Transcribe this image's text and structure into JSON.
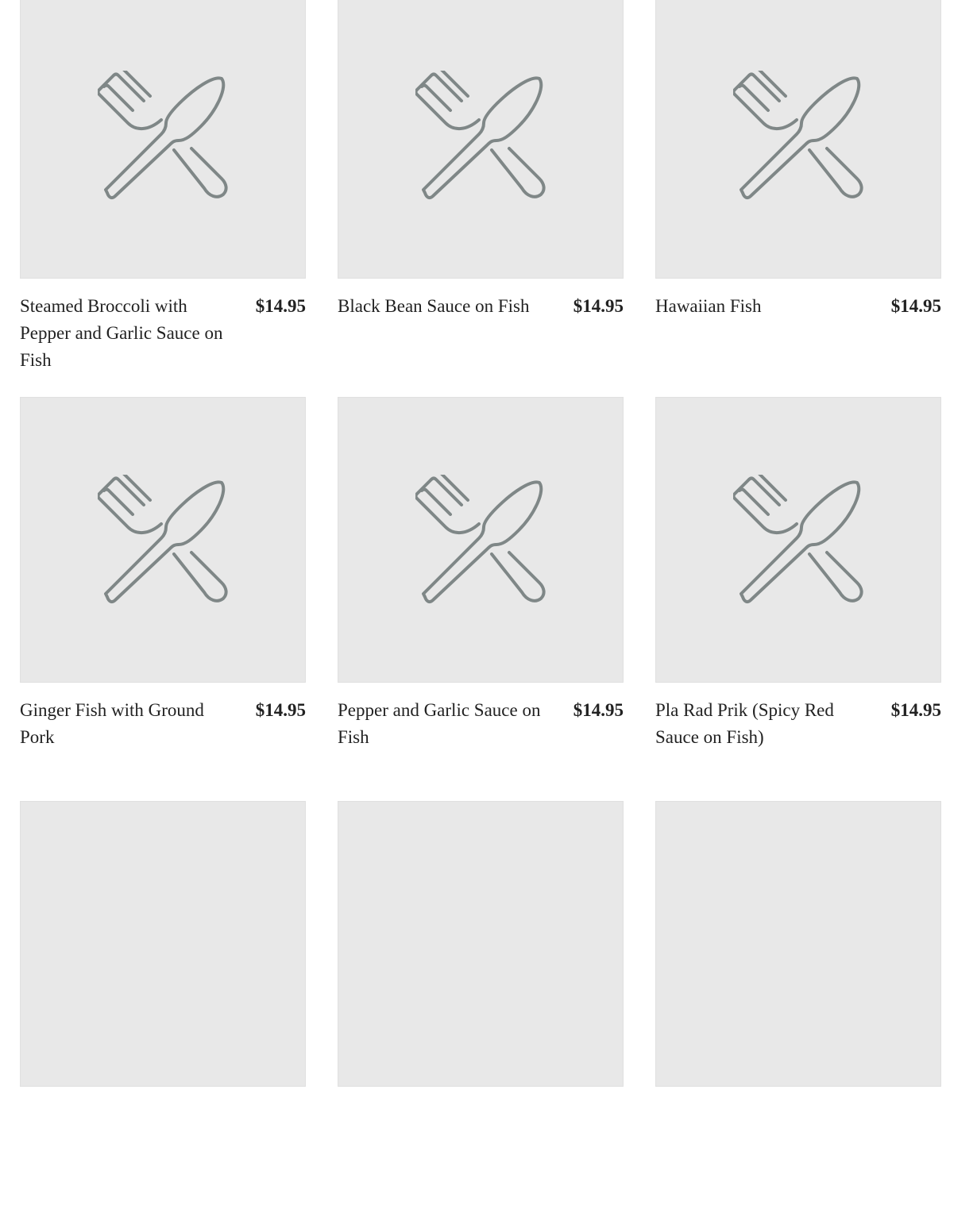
{
  "menu": {
    "items": [
      {
        "name": "Steamed Broccoli with Pepper and Garlic Sauce on Fish",
        "price": "$14.95",
        "image_icon": "fork-knife-icon"
      },
      {
        "name": "Black Bean Sauce on Fish",
        "price": "$14.95",
        "image_icon": "fork-knife-icon"
      },
      {
        "name": "Hawaiian Fish",
        "price": "$14.95",
        "image_icon": "fork-knife-icon"
      },
      {
        "name": "Ginger Fish with Ground Pork",
        "price": "$14.95",
        "image_icon": "fork-knife-icon"
      },
      {
        "name": "Pepper and Garlic Sauce on Fish",
        "price": "$14.95",
        "image_icon": "fork-knife-icon"
      },
      {
        "name": "Pla Rad Prik (Spicy Red Sauce on Fish)",
        "price": "$14.95",
        "image_icon": "fork-knife-icon"
      },
      {
        "name": "",
        "price": "",
        "image_icon": "fork-knife-icon"
      },
      {
        "name": "",
        "price": "",
        "image_icon": "fork-knife-icon"
      },
      {
        "name": "",
        "price": "",
        "image_icon": "fork-knife-icon"
      }
    ]
  },
  "colors": {
    "placeholder_bg": "#e8e8e8",
    "icon_stroke": "#7f8787",
    "text": "#222222"
  }
}
